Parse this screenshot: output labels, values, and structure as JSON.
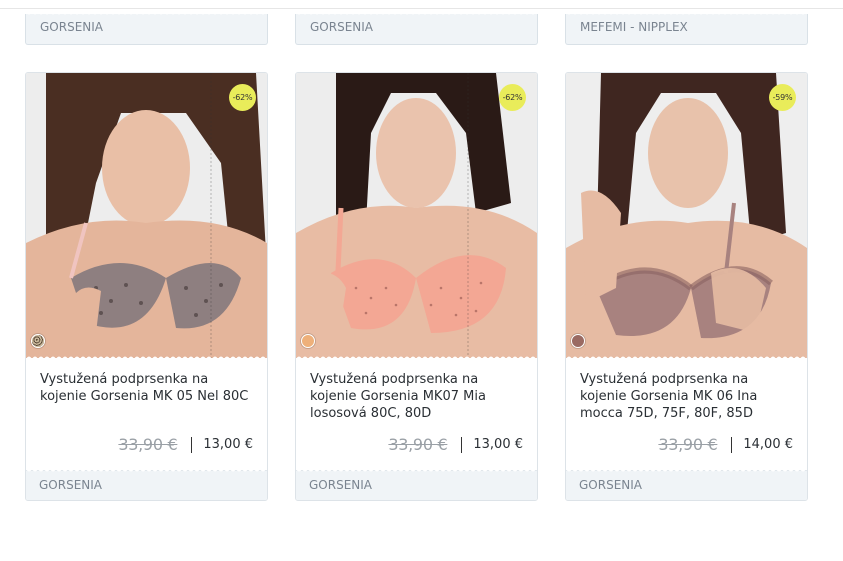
{
  "top_row": [
    {
      "brand": "GORSENIA"
    },
    {
      "brand": "GORSENIA"
    },
    {
      "brand": "MEFEMI - NIPPLEX"
    }
  ],
  "products": [
    {
      "title": "Vystužená podprsenka na kojenie Gorsenia MK 05 Nel 80C",
      "discount": "-62%",
      "old_price": "33,90 €",
      "price": "13,00 €",
      "brand": "GORSENIA",
      "swatch_color": "#c9b89a",
      "bra_color": "#8e7f80"
    },
    {
      "title": "Vystužená podprsenka na kojenie Gorsenia MK07 Mia lososová 80C, 80D",
      "discount": "-62%",
      "old_price": "33,90 €",
      "price": "13,00 €",
      "brand": "GORSENIA",
      "swatch_color": "#eeb07a",
      "bra_color": "#f3a794"
    },
    {
      "title": "Vystužená podprsenka na kojenie Gorsenia MK 06 Ina mocca 75D, 75F, 80F, 85D",
      "discount": "-59%",
      "old_price": "33,90 €",
      "price": "14,00 €",
      "brand": "GORSENIA",
      "swatch_color": "#9a6a62",
      "bra_color": "#a8827f"
    }
  ]
}
